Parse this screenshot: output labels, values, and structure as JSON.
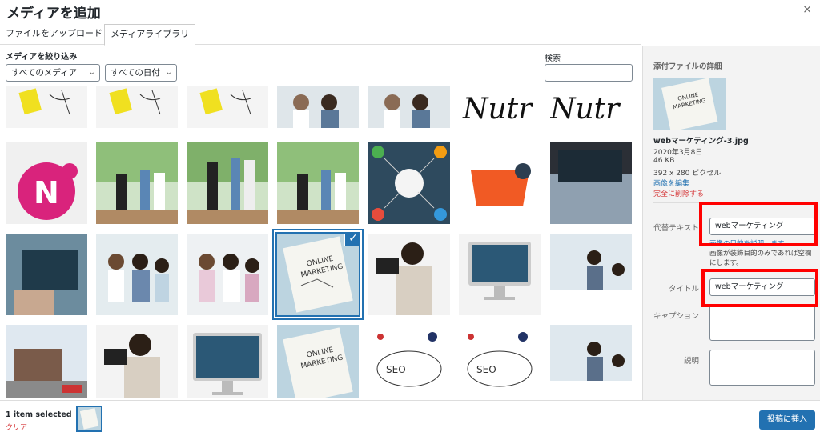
{
  "header": {
    "title": "メディアを追加",
    "close": "×"
  },
  "tabs": [
    {
      "label": "ファイルをアップロード"
    },
    {
      "label": "メディアライブラリ"
    }
  ],
  "filters": {
    "heading": "メディアを絞り込み",
    "type_value": "すべてのメディア",
    "date_value": "すべての日付",
    "search_label": "検索",
    "search_value": ""
  },
  "sidebar": {
    "heading": "添付ファイルの詳細",
    "filename": "webマーケティング-3.jpg",
    "date": "2020年3月8日",
    "size": "46 KB",
    "dimensions": "392 x 280 ピクセル",
    "edit_link": "画像を編集",
    "delete_link": "完全に削除する",
    "alt_label": "代替テキスト",
    "alt_value": "webマーケティング",
    "alt_hint": "画像の目的を説明します。",
    "alt_hint2": "画像が装飾目的のみであれば空欄にします。",
    "title_label": "タイトル",
    "title_value": "webマーケティング",
    "caption_label": "キャプション",
    "description_label": "説明"
  },
  "footer": {
    "selected_text": "1 item selected",
    "clear_link": "クリア",
    "insert_button": "投稿に挿入"
  },
  "colors": {
    "accent": "#2271b1",
    "danger": "#d63638",
    "highlight": "#ff0000"
  }
}
